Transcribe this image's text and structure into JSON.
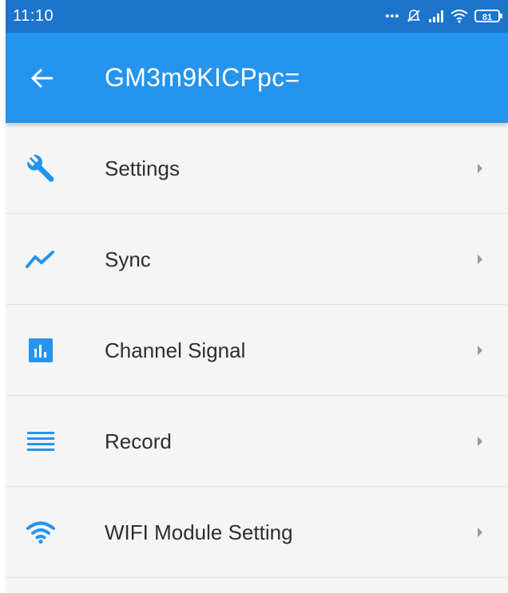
{
  "status_bar": {
    "time": "11:10",
    "battery": "81"
  },
  "app_bar": {
    "title": "GM3m9KICPpc="
  },
  "menu": {
    "items": [
      {
        "label": "Settings",
        "icon": "wrench-icon"
      },
      {
        "label": "Sync",
        "icon": "line-chart-icon"
      },
      {
        "label": "Channel Signal",
        "icon": "bar-chart-icon"
      },
      {
        "label": "Record",
        "icon": "list-lines-icon"
      },
      {
        "label": "WIFI Module Setting",
        "icon": "wifi-icon"
      }
    ]
  },
  "colors": {
    "status_bar": "#1c74cc",
    "app_bar": "#2494ee",
    "accent_icon": "#2494ee",
    "background": "#f5f5f5"
  }
}
